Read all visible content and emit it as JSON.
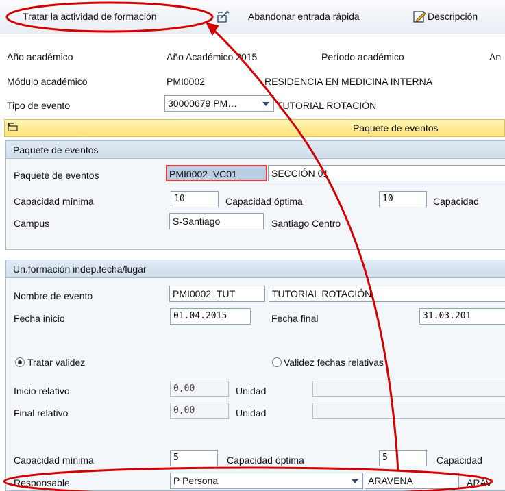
{
  "toolbar": {
    "process_btn": "Tratar la actividad de formación",
    "quick_entry_btn": "Abandonar entrada rápida",
    "description_btn": "Descripción"
  },
  "header": {
    "year_label": "Año académico",
    "year_value": "Año Académico 2015",
    "period_label": "Período académico",
    "period_cut": "An",
    "module_label": "Módulo académico",
    "module_code": "PMI0002",
    "module_name": "RESIDENCIA EN MEDICINA INTERNA",
    "event_type_label": "Tipo de evento",
    "event_type_code": "30000679 PM…",
    "event_type_name": "TUTORIAL ROTACIÓN"
  },
  "tabstrip": {
    "title": "Paquete de eventos"
  },
  "package": {
    "title": "Paquete de eventos",
    "pkg_label": "Paquete de eventos",
    "pkg_code": "PMI0002_VC01",
    "pkg_name": "SECCIÓN 01",
    "min_label": "Capacidad mínima",
    "min_value": "10",
    "opt_label": "Capacidad óptima",
    "opt_value": "10",
    "max_cut": "Capacidad",
    "campus_label": "Campus",
    "campus_value": "S-Santiago",
    "campus_name": "Santiago Centro"
  },
  "training": {
    "title": "Un.formación indep.fecha/lugar",
    "event_name_label": "Nombre de evento",
    "event_code": "PMI0002_TUT",
    "event_name": "TUTORIAL ROTACIÓN",
    "start_label": "Fecha inicio",
    "start_value": "01.04.2015",
    "end_label": "Fecha final",
    "end_value": "31.03.201",
    "radio_validity": "Tratar validez",
    "radio_relative": "Validez fechas relativas",
    "rel_start_label": "Inicio relativo",
    "rel_start_value": "0,00",
    "unit_label": "Unidad",
    "rel_end_label": "Final relativo",
    "rel_end_value": "0,00",
    "unit_label2": "Unidad",
    "min_label": "Capacidad mínima",
    "min_value": "5",
    "opt_label": "Capacidad óptima",
    "opt_value": "5",
    "max_cut": "Capacidad",
    "resp_label": "Responsable",
    "resp_type": "P Persona",
    "resp_value": "ARAVENA",
    "resp_cut": "ARAV"
  },
  "annotation_color": "#d40000"
}
